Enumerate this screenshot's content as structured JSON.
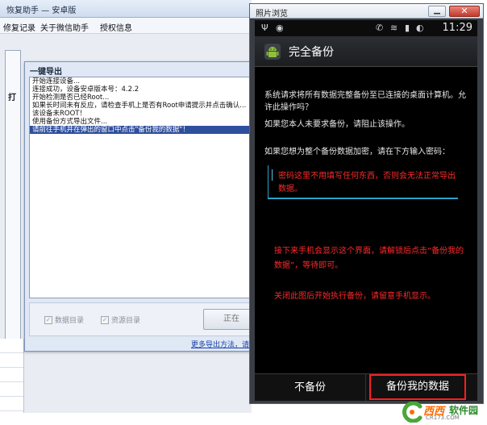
{
  "bg_app": {
    "title": "恢复助手 — 安卓版",
    "menu": [
      "修复记录",
      "关于微信助手",
      "授权信息"
    ],
    "frame_tab": "打"
  },
  "dialog": {
    "title": "一键导出",
    "log_lines": [
      "开始连接设备...",
      "连接成功，设备安卓版本号：4.2.2",
      "开始检测是否已经Root...",
      "如果长时间未有反应，请检查手机上是否有Root申请提示并点击确认...",
      "该设备未ROOT！",
      "使用备份方式导出文件...",
      "请前往手机并在弹出的窗口中点击\"备份我的数据\"！"
    ],
    "checkbox_data": "数据目录",
    "checkbox_resource": "资源目录",
    "start_button": "正在",
    "more_link": "更多导出方法，请看"
  },
  "photo_window": {
    "title": "照片浏览",
    "close_label": "✕",
    "minimize_label": "▁"
  },
  "phone": {
    "time": "11:29",
    "action_title": "完全备份",
    "para1": "系统请求将所有数据完整备份至已连接的桌面计算机。允许此操作吗？",
    "para2": "如果您本人未要求备份，请阻止该操作。",
    "para3": "如果您想为整个备份数据加密，请在下方输入密码：",
    "password_note": "密码这里不用填写任何东西，否则会无法正常导出数据。",
    "note1": "接下来手机会显示这个界面，请解锁后点击“备份我的数据”，等待即可。",
    "note2": "关闭此图后开始执行备份，请留意手机显示。",
    "btn_skip": "不备份",
    "btn_backup": "备份我的数据"
  },
  "watermark": {
    "brand1": "西西",
    "brand2": "软件园",
    "url": "CR173.COM"
  },
  "colors": {
    "accent_red": "#ff1e1e",
    "input_blue": "#2aa2c9",
    "selection": "#2e4e9e"
  }
}
